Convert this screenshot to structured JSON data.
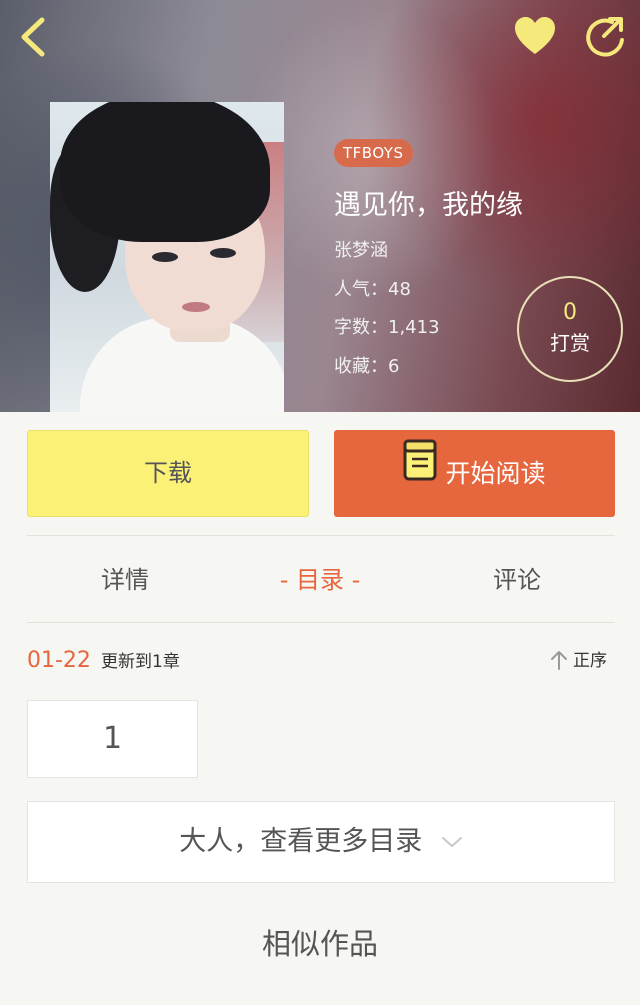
{
  "header": {
    "back_icon": "chevron-left-icon",
    "favorite_icon": "heart-icon",
    "share_icon": "share-arrow-icon",
    "icon_color": "#f4e97a"
  },
  "book": {
    "tag": "TFBOYS",
    "title": "遇见你，我的缘",
    "author": "张梦涵",
    "popularity": "人气：48",
    "word_count": "字数：1,413",
    "favorites": "收藏：6"
  },
  "tip": {
    "count": "0",
    "label": "打赏"
  },
  "actions": {
    "download_label": "下载",
    "read_label": "开始阅读",
    "read_icon": "book-icon"
  },
  "tabs": [
    {
      "label": "详情",
      "active": false
    },
    {
      "label": "- 目录 -",
      "active": true
    },
    {
      "label": "评论",
      "active": false
    }
  ],
  "toc": {
    "update_date": "01-22",
    "update_text": "更新到1章",
    "sort_label": "正序",
    "sort_icon": "arrow-up-icon",
    "chapters": [
      "1"
    ],
    "more_label": "大人，查看更多目录",
    "more_icon": "chevron-down-icon"
  },
  "similar": {
    "title": "相似作品"
  },
  "colors": {
    "accent": "#e6663e",
    "download": "#fbf176",
    "tag": "#d86a4c"
  }
}
